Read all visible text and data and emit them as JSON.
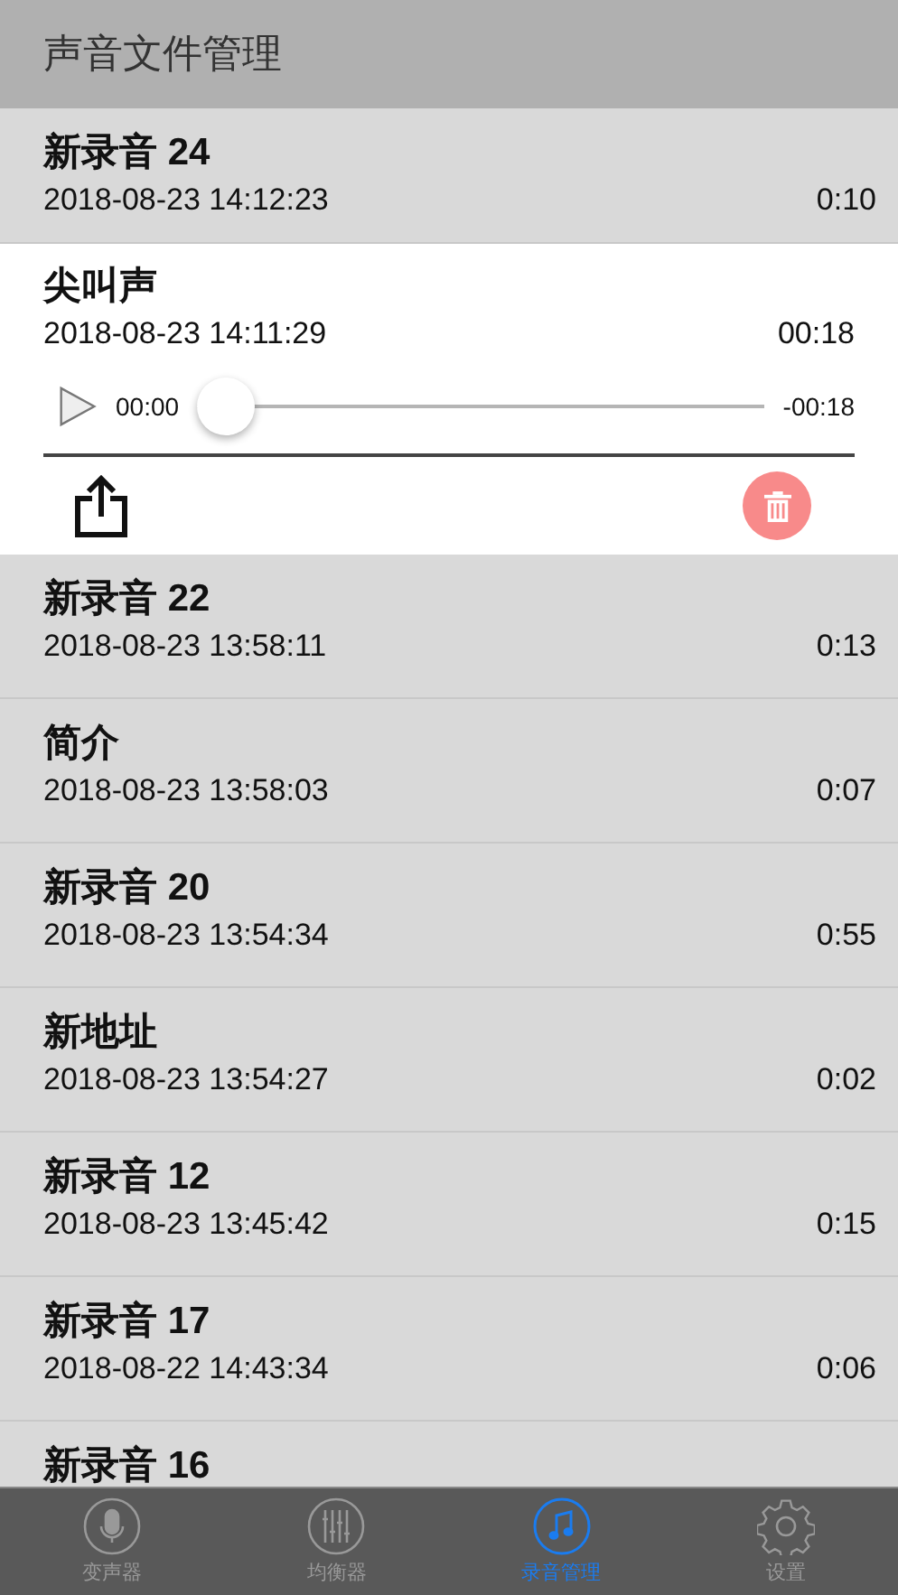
{
  "header": {
    "title": "声音文件管理"
  },
  "recordings": [
    {
      "title": "新录音 24",
      "date": "2018-08-23 14:12:23",
      "duration": "0:10",
      "expanded": false
    },
    {
      "title": "尖叫声",
      "date": "2018-08-23 14:11:29",
      "duration": "00:18",
      "expanded": true,
      "player": {
        "elapsed": "00:00",
        "remaining": "-00:18",
        "level": 0
      }
    },
    {
      "title": "新录音 22",
      "date": "2018-08-23 13:58:11",
      "duration": "0:13",
      "expanded": false
    },
    {
      "title": "简介",
      "date": "2018-08-23 13:58:03",
      "duration": "0:07",
      "expanded": false
    },
    {
      "title": "新录音 20",
      "date": "2018-08-23 13:54:34",
      "duration": "0:55",
      "expanded": false
    },
    {
      "title": "新地址",
      "date": "2018-08-23 13:54:27",
      "duration": "0:02",
      "expanded": false
    },
    {
      "title": "新录音 12",
      "date": "2018-08-23 13:45:42",
      "duration": "0:15",
      "expanded": false
    },
    {
      "title": "新录音 17",
      "date": "2018-08-22 14:43:34",
      "duration": "0:06",
      "expanded": false
    },
    {
      "title": "新录音 16",
      "expanded": false
    }
  ],
  "tabs": [
    {
      "label": "变声器",
      "kind": "mic",
      "selected": false
    },
    {
      "label": "均衡器",
      "kind": "equalizer",
      "selected": false
    },
    {
      "label": "录音管理",
      "kind": "music",
      "selected": true
    },
    {
      "label": "设置",
      "kind": "settings",
      "selected": false
    }
  ]
}
